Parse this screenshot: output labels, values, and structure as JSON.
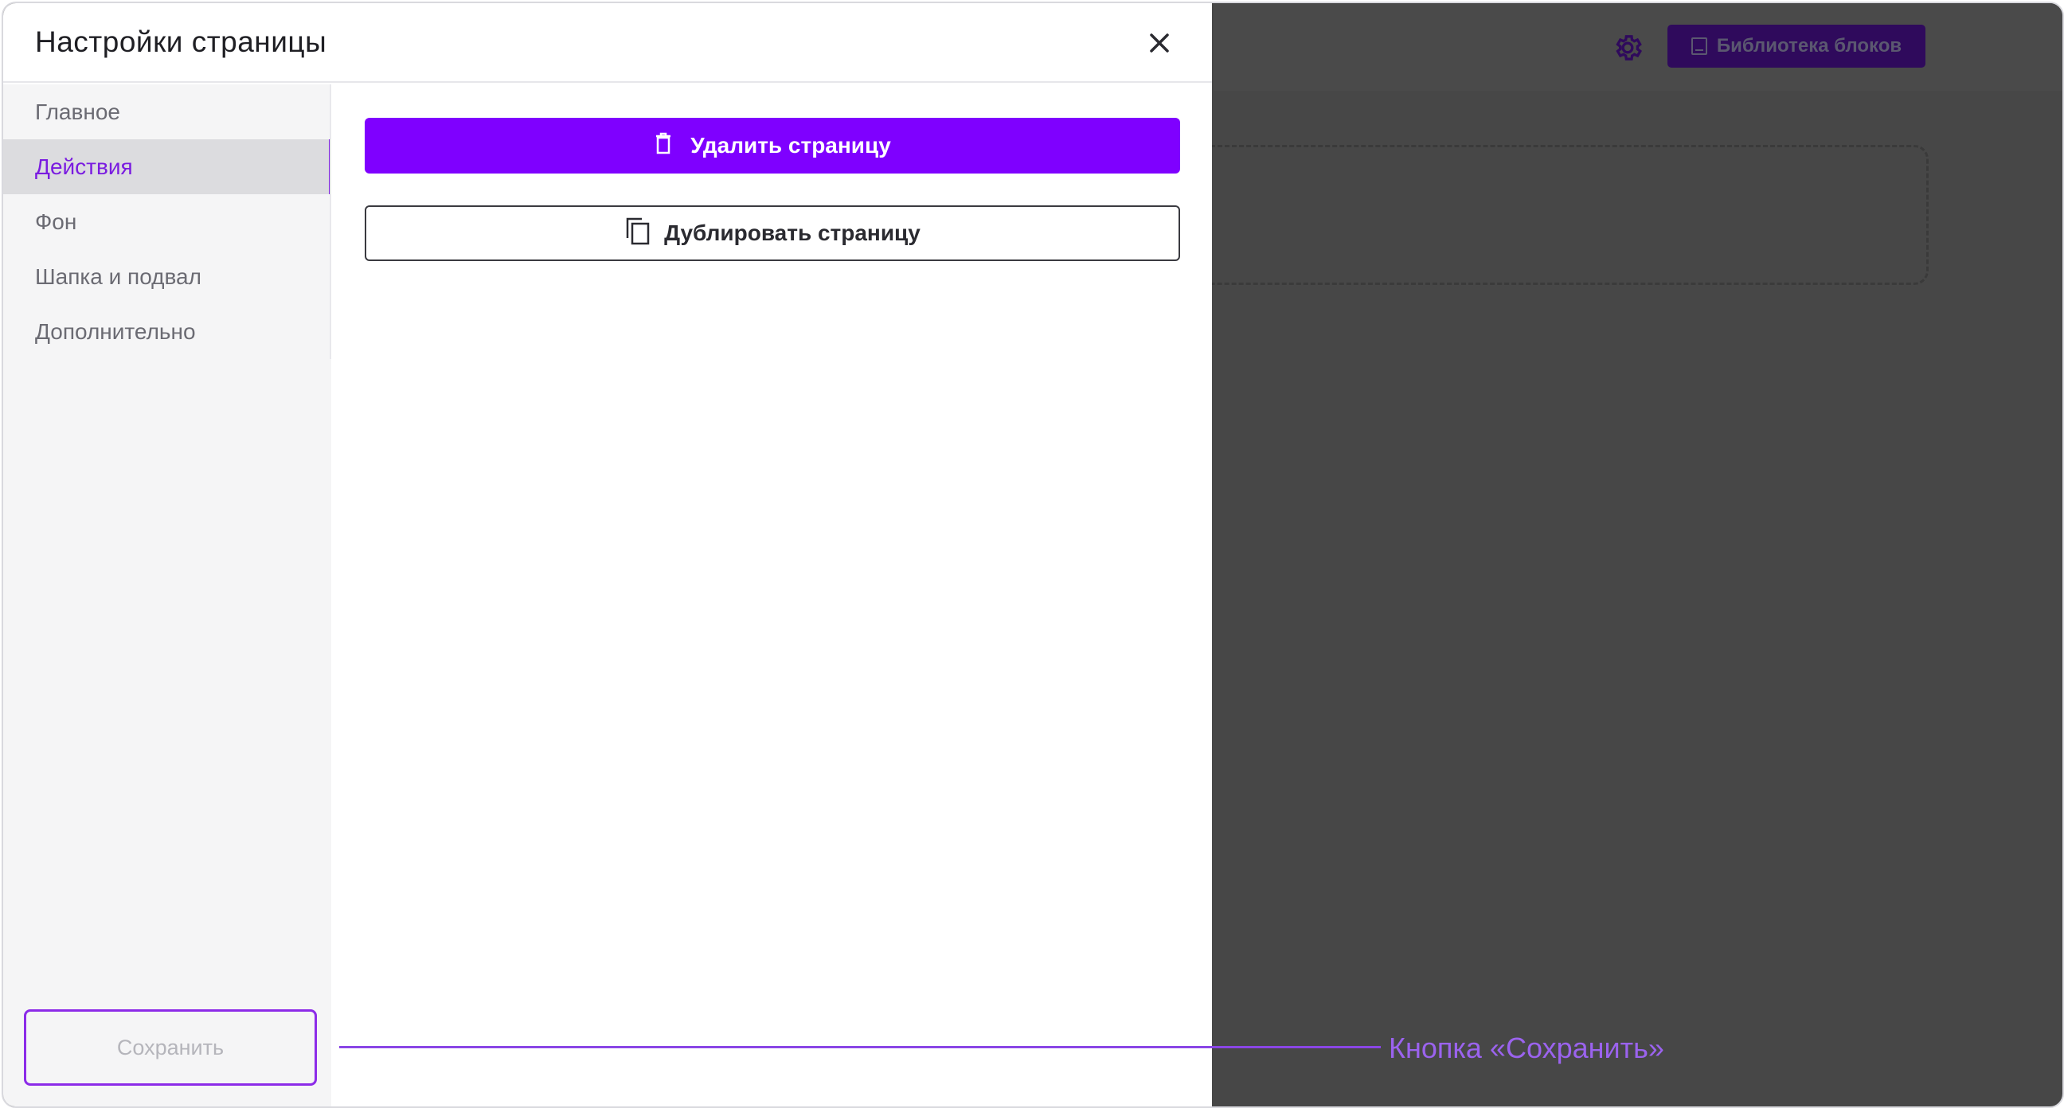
{
  "panel": {
    "title": "Настройки страницы",
    "close_icon": "close-icon"
  },
  "sidebar": {
    "items": [
      {
        "label": "Главное",
        "active": false
      },
      {
        "label": "Действия",
        "active": true
      },
      {
        "label": "Фон",
        "active": false
      },
      {
        "label": "Шапка и подвал",
        "active": false
      },
      {
        "label": "Дополнительно",
        "active": false
      }
    ],
    "save_label": "Сохранить"
  },
  "actions": {
    "delete_label": "Удалить страницу",
    "delete_icon": "trash-icon",
    "duplicate_label": "Дублировать страницу",
    "duplicate_icon": "copy-icon"
  },
  "background_editor": {
    "settings_icon": "gear-icon",
    "library_label": "Библиотека блоков",
    "library_icon": "library-icon"
  },
  "annotation": {
    "label": "Кнопка «Сохранить»"
  },
  "colors": {
    "accent": "#7f00ff",
    "active_text": "#7a1ce0",
    "overlay": "#474747",
    "annotation": "#9b63ee"
  }
}
